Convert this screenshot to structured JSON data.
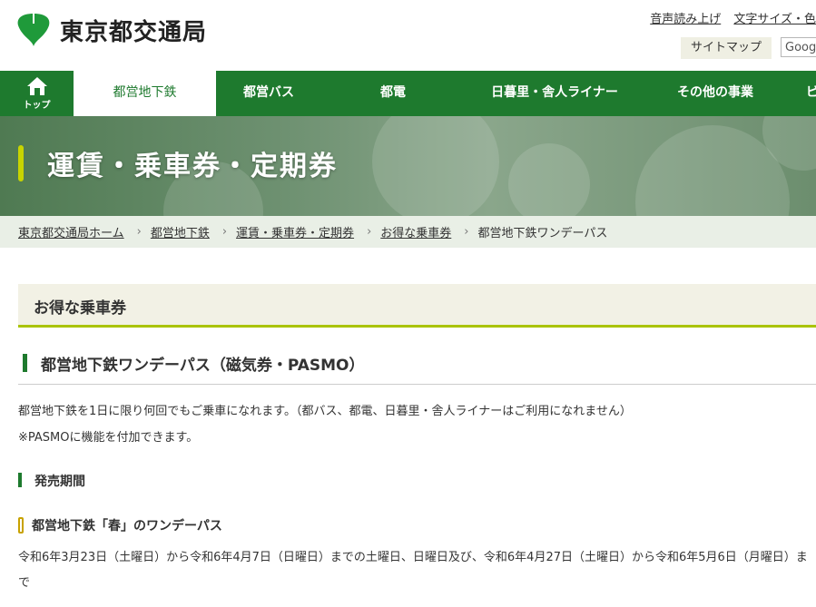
{
  "header": {
    "logo_text": "東京都交通局",
    "util_links": [
      "音声読み上げ",
      "文字サイズ・色"
    ],
    "sitemap_label": "サイトマップ",
    "search_placeholder": "Google"
  },
  "nav": {
    "home_label": "トップ",
    "items": [
      "都営地下鉄",
      "都営バス",
      "都電",
      "日暮里・舎人ライナー",
      "その他の事業",
      "ビ"
    ]
  },
  "hero": {
    "title": "運賃・乗車券・定期券"
  },
  "breadcrumb": {
    "items": [
      "東京都交通局ホーム",
      "都営地下鉄",
      "運賃・乗車券・定期券",
      "お得な乗車券"
    ],
    "current": "都営地下鉄ワンデーパス"
  },
  "content": {
    "section_title": "お得な乗車券",
    "heading": "都営地下鉄ワンデーパス（磁気券・PASMO）",
    "desc1": "都営地下鉄を1日に限り何回でもご乗車になれます。（都バス、都電、日暮里・舎人ライナーはご利用になれません）",
    "desc2": "※PASMOに機能を付加できます。",
    "sub_heading": "発売期間",
    "sub_sub_heading": "都営地下鉄「春」のワンデーパス",
    "period_text": "令和6年3月23日（土曜日）から令和6年4月7日（日曜日）までの土曜日、日曜日及び、令和6年4月27日（土曜日）から令和6年5月6日（月曜日）まで"
  },
  "colors": {
    "brand_green": "#1e7a2e",
    "accent_lime": "#aac300",
    "breadcrumb_bg": "#e9efe6",
    "section_bg": "#f2f1e5"
  }
}
